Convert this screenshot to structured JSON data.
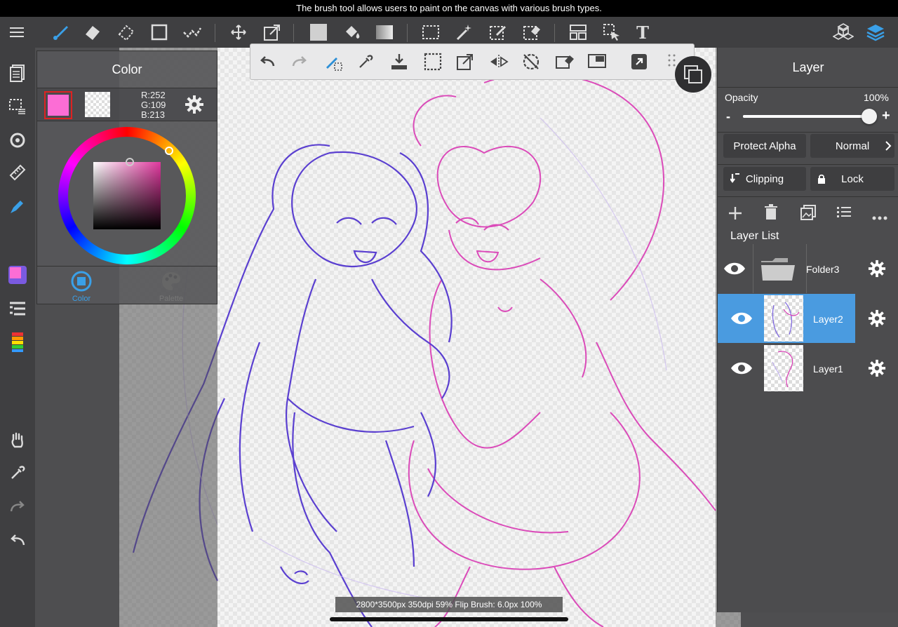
{
  "caption": {
    "text": "The brush tool allows users to paint on the canvas with various brush types."
  },
  "toolbar": {
    "left_icons": [
      "menu-icon",
      "brush-icon",
      "eraser-icon",
      "blur-eraser-icon",
      "rectangle-icon",
      "dotted-line-icon",
      "move-icon",
      "transform-icon",
      "fill-color-icon",
      "bucket-icon",
      "gradient-icon",
      "select-rect-icon",
      "magic-wand-icon",
      "select-pen-icon",
      "select-eraser-icon",
      "panel-layout-icon",
      "select-arrow-icon",
      "text-icon"
    ],
    "right_icons": [
      "materials-icon",
      "layers-icon"
    ],
    "text_tool_label": "T"
  },
  "float_bar": {
    "icons": [
      "undo-icon",
      "redo-icon",
      "brush-clear-icon",
      "eyedropper-icon",
      "import-icon",
      "deselect-icon",
      "transform-icon",
      "flip-icon",
      "rotate-reset-icon",
      "clear-icon",
      "window-icon",
      "expand-icon",
      "grid-icon"
    ]
  },
  "color_panel": {
    "title": "Color",
    "main_color": "#fc6dd5",
    "r": "R:252",
    "g": "G:109",
    "b": "B:213",
    "tabs": [
      {
        "label": "Color",
        "active": true
      },
      {
        "label": "Palette",
        "active": false
      }
    ]
  },
  "left_rail": {
    "icons": [
      "pages-icon",
      "selection-layer-icon",
      "rotate-icon",
      "ruler-icon",
      "pen-icon",
      "color-swatch-icon",
      "layer-list-icon",
      "color-bars-icon",
      "hand-icon",
      "eyedropper-icon",
      "redo-icon",
      "undo-icon"
    ]
  },
  "layer_panel": {
    "title": "Layer",
    "opacity_label": "Opacity",
    "opacity_value": "100%",
    "opacity_fraction": 1.0,
    "minus": "-",
    "plus": "+",
    "protect_alpha": "Protect Alpha",
    "blend_mode": "Normal",
    "clipping": "Clipping",
    "lock": "Lock",
    "list_title": "Layer List",
    "layers": [
      {
        "name": "Folder3",
        "type": "folder",
        "selected": false
      },
      {
        "name": "Layer2",
        "type": "layer",
        "selected": true
      },
      {
        "name": "Layer1",
        "type": "layer",
        "selected": false
      }
    ]
  },
  "status": {
    "text": "2800*3500px 350dpi 59% Flip Brush: 6.0px 100%"
  },
  "colors": {
    "accent": "#4a9be0",
    "selected_row": "#4a9be0",
    "sketch_purple": "#5a3fd0",
    "sketch_pink": "#d93ab4"
  }
}
